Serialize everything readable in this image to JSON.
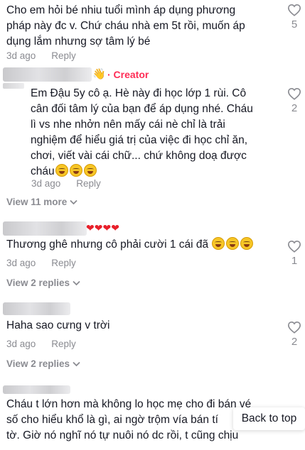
{
  "comments": [
    {
      "lines": [
        "Cho em hỏi bé nhiu tuổi mình áp dụng phương",
        "pháp này đc v. Chứ cháu nhà em 5t rồi, muốn áp",
        "dụng lắm nhưng sợ tâm lý bé"
      ],
      "time": "3d ago",
      "reply_label": "Reply",
      "likes": "5"
    },
    {
      "creator_label": "· Creator",
      "lines": [
        "Em Đậu 5y cô ạ. Hè này đi học lớp 1 rùi. Cô",
        "cân đối tâm lý của bạn để áp dụng nhé. Cháu",
        "lì vs nhe nhởn nên mấy cái nè chỉ là trải",
        "nghiệm để hiểu giá trị của việc đi học chỉ ăn,",
        "chơi, viết vài cái chữ... chứ không doạ được",
        "cháu"
      ],
      "time": "3d ago",
      "reply_label": "Reply",
      "likes": "2",
      "view_more": "View 11 more"
    },
    {
      "lines": [
        "Thương ghê nhưng cô phải cười 1 cái đã"
      ],
      "time": "3d ago",
      "reply_label": "Reply",
      "likes": "1",
      "view_more": "View 2 replies"
    },
    {
      "lines": [
        "Haha sao cưng v trời"
      ],
      "time": "3d ago",
      "reply_label": "Reply",
      "likes": "2",
      "view_more": "View 2 replies"
    },
    {
      "lines": [
        "Cháu t lớn hơn mà không lo học mẹ cho đi bán vé",
        "số cho hiểu khổ là gì, ai ngờ trộm vía bán tí",
        "tờ. Giờ nó nghĩ nó tự nuôi nó dc rồi, t cũng chịu"
      ]
    }
  ],
  "back_to_top": "Back to top",
  "icons": {
    "like": "heart-outline-icon",
    "view_more": "chevron-down-icon",
    "wave": "waving-hand-icon"
  }
}
